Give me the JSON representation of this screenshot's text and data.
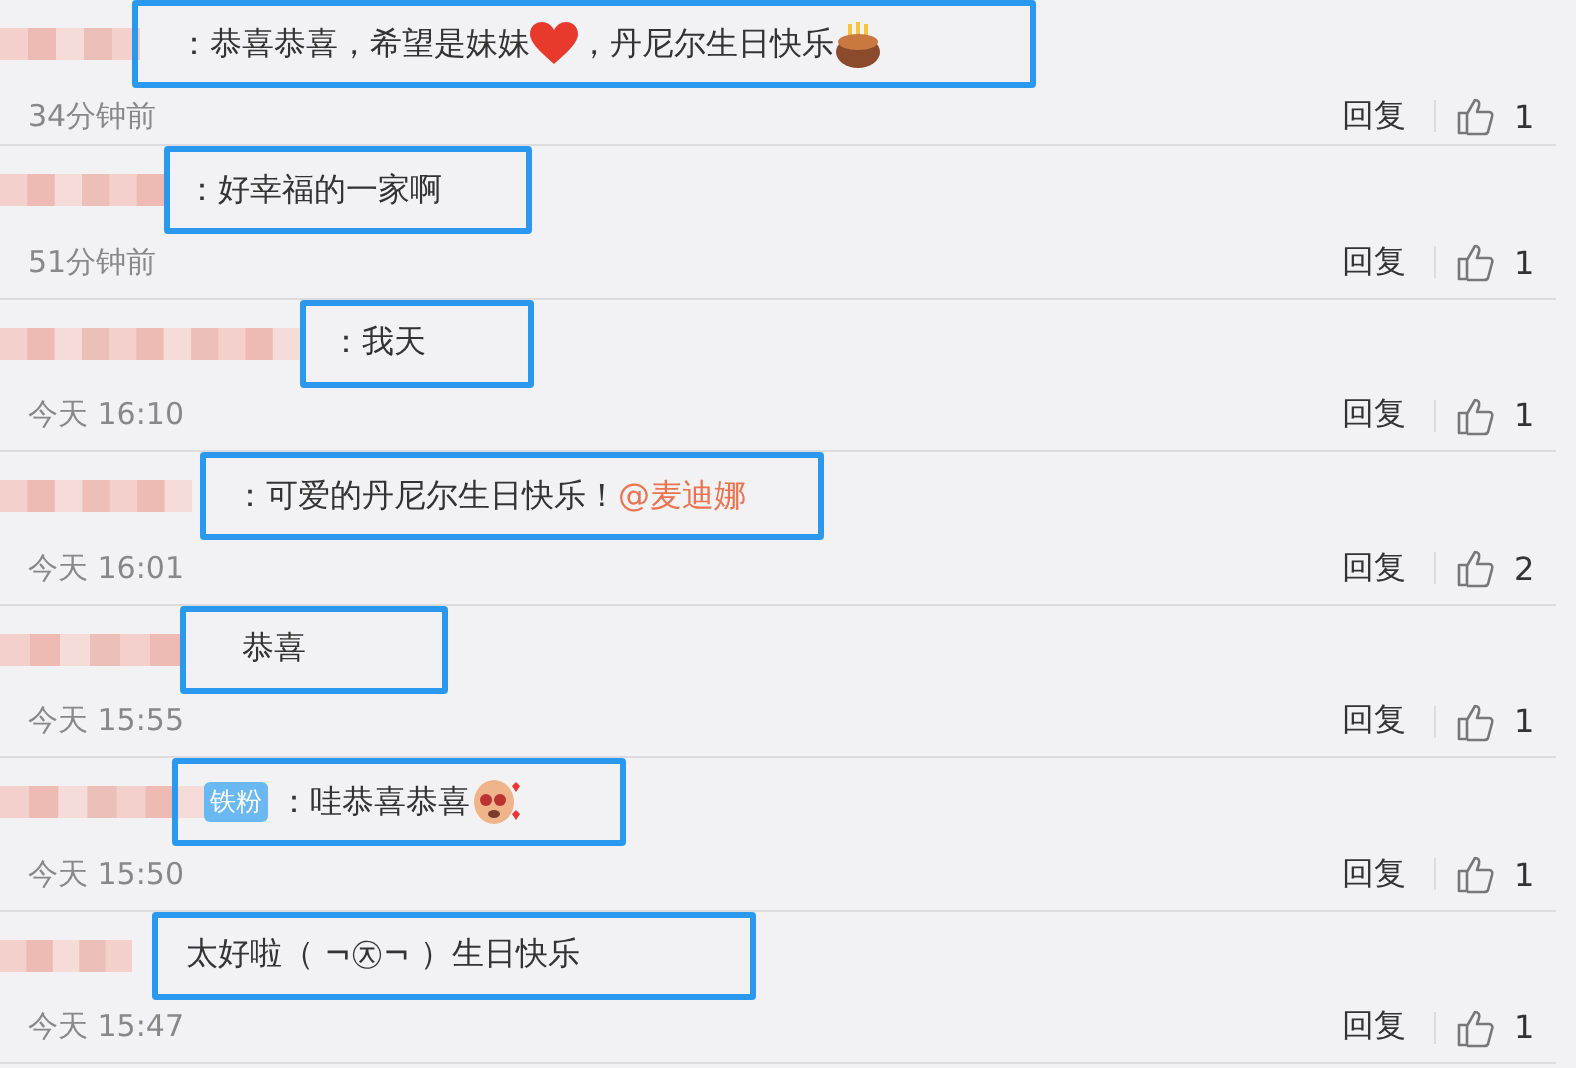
{
  "comments": [
    {
      "segments": [
        {
          "kind": "text",
          "text": "：恭喜恭喜，希望是妹妹"
        },
        {
          "kind": "heart"
        },
        {
          "kind": "text",
          "text": "，丹尼尔生日快乐"
        },
        {
          "kind": "cake"
        }
      ],
      "highlighted": true,
      "time": "34分钟前",
      "reply": "回复",
      "likes": "1"
    },
    {
      "segments": [
        {
          "kind": "text",
          "text": "：好幸福的一家啊"
        }
      ],
      "highlighted": true,
      "time": "51分钟前",
      "reply": "回复",
      "likes": "1"
    },
    {
      "segments": [
        {
          "kind": "text",
          "text": "：我天"
        }
      ],
      "highlighted": true,
      "time": "今天 16:10",
      "reply": "回复",
      "likes": "1"
    },
    {
      "segments": [
        {
          "kind": "text",
          "text": "：可爱的丹尼尔生日快乐！"
        },
        {
          "kind": "mention",
          "text": "@麦迪娜"
        }
      ],
      "highlighted": true,
      "time": "今天 16:01",
      "reply": "回复",
      "likes": "2"
    },
    {
      "segments": [
        {
          "kind": "text",
          "text": "恭喜"
        }
      ],
      "highlighted": true,
      "time": "今天 15:55",
      "reply": "回复",
      "likes": "1"
    },
    {
      "badge": "铁粉",
      "segments": [
        {
          "kind": "text",
          "text": "：哇恭喜恭喜"
        },
        {
          "kind": "sticker"
        }
      ],
      "highlighted": true,
      "time": "今天 15:50",
      "reply": "回复",
      "likes": "1"
    },
    {
      "segments": [
        {
          "kind": "text",
          "text": "太好啦（ ¬㉨¬ ）生日快乐"
        }
      ],
      "highlighted": true,
      "time": "今天 15:47",
      "reply": "回复",
      "likes": "1"
    }
  ]
}
